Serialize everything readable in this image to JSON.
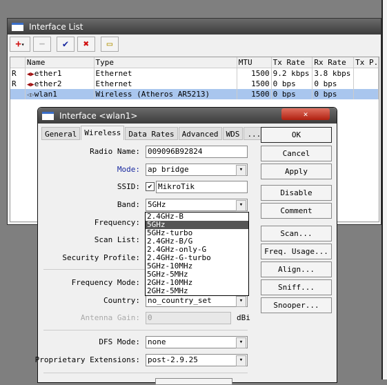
{
  "list_window": {
    "title": "Interface List",
    "toolbar": {
      "add": "+",
      "remove": "−",
      "enable": "✔",
      "disable": "✖",
      "comment": "▭"
    },
    "columns": [
      "",
      "Name",
      "Type",
      "MTU",
      "Tx Rate",
      "Rx Rate",
      "Tx P.."
    ],
    "rows": [
      {
        "flag": "R",
        "name": "ether1",
        "type": "Ethernet",
        "mtu": "1500",
        "tx": "9.2 kbps",
        "rx": "3.8 kbps",
        "icon": "ethernet-icon"
      },
      {
        "flag": "R",
        "name": "ether2",
        "type": "Ethernet",
        "mtu": "1500",
        "tx": "0 bps",
        "rx": "0 bps",
        "icon": "ethernet-icon"
      },
      {
        "flag": "",
        "name": "wlan1",
        "type": "Wireless (Atheros AR5213)",
        "mtu": "1500",
        "tx": "0 bps",
        "rx": "0 bps",
        "icon": "wireless-icon",
        "selected": true
      }
    ]
  },
  "dialog": {
    "title": "Interface <wlan1>",
    "close": "✕",
    "tabs": [
      "General",
      "Wireless",
      "Data Rates",
      "Advanced",
      "WDS",
      "..."
    ],
    "active_tab": "Wireless",
    "fields": {
      "radio_name": {
        "label": "Radio Name:",
        "value": "009096B92824"
      },
      "mode": {
        "label": "Mode:",
        "value": "ap bridge"
      },
      "ssid": {
        "label": "SSID:",
        "value": "MikroTik",
        "checked": true
      },
      "band": {
        "label": "Band:",
        "value": "5GHz"
      },
      "frequency": {
        "label": "Frequency:"
      },
      "scan_list": {
        "label": "Scan List:"
      },
      "security_profile": {
        "label": "Security Profile:"
      },
      "frequency_mode": {
        "label": "Frequency Mode:"
      },
      "country": {
        "label": "Country:",
        "value": "no_country_set"
      },
      "antenna_gain": {
        "label": "Antenna Gain:",
        "value": "0",
        "unit": "dBi"
      },
      "dfs_mode": {
        "label": "DFS Mode:",
        "value": "none"
      },
      "proprietary_extensions": {
        "label": "Proprietary Extensions:",
        "value": "post-2.9.25"
      }
    },
    "band_options": [
      "2.4GHz-B",
      "5GHz",
      "5GHz-turbo",
      "2.4GHz-B/G",
      "2.4GHz-only-G",
      "2.4GHz-G-turbo",
      "5GHz-10MHz",
      "5GHz-5MHz",
      "2GHz-10MHz",
      "2GHz-5MHz"
    ],
    "band_highlighted": "5GHz",
    "buttons": [
      "OK",
      "Cancel",
      "Apply",
      "Disable",
      "Comment",
      "Scan...",
      "Freq. Usage...",
      "Align...",
      "Sniff...",
      "Snooper..."
    ]
  },
  "colors": {
    "selection": "#a9c6ee",
    "mode_label": "#1a2aa0",
    "close_button": "#c03020"
  }
}
